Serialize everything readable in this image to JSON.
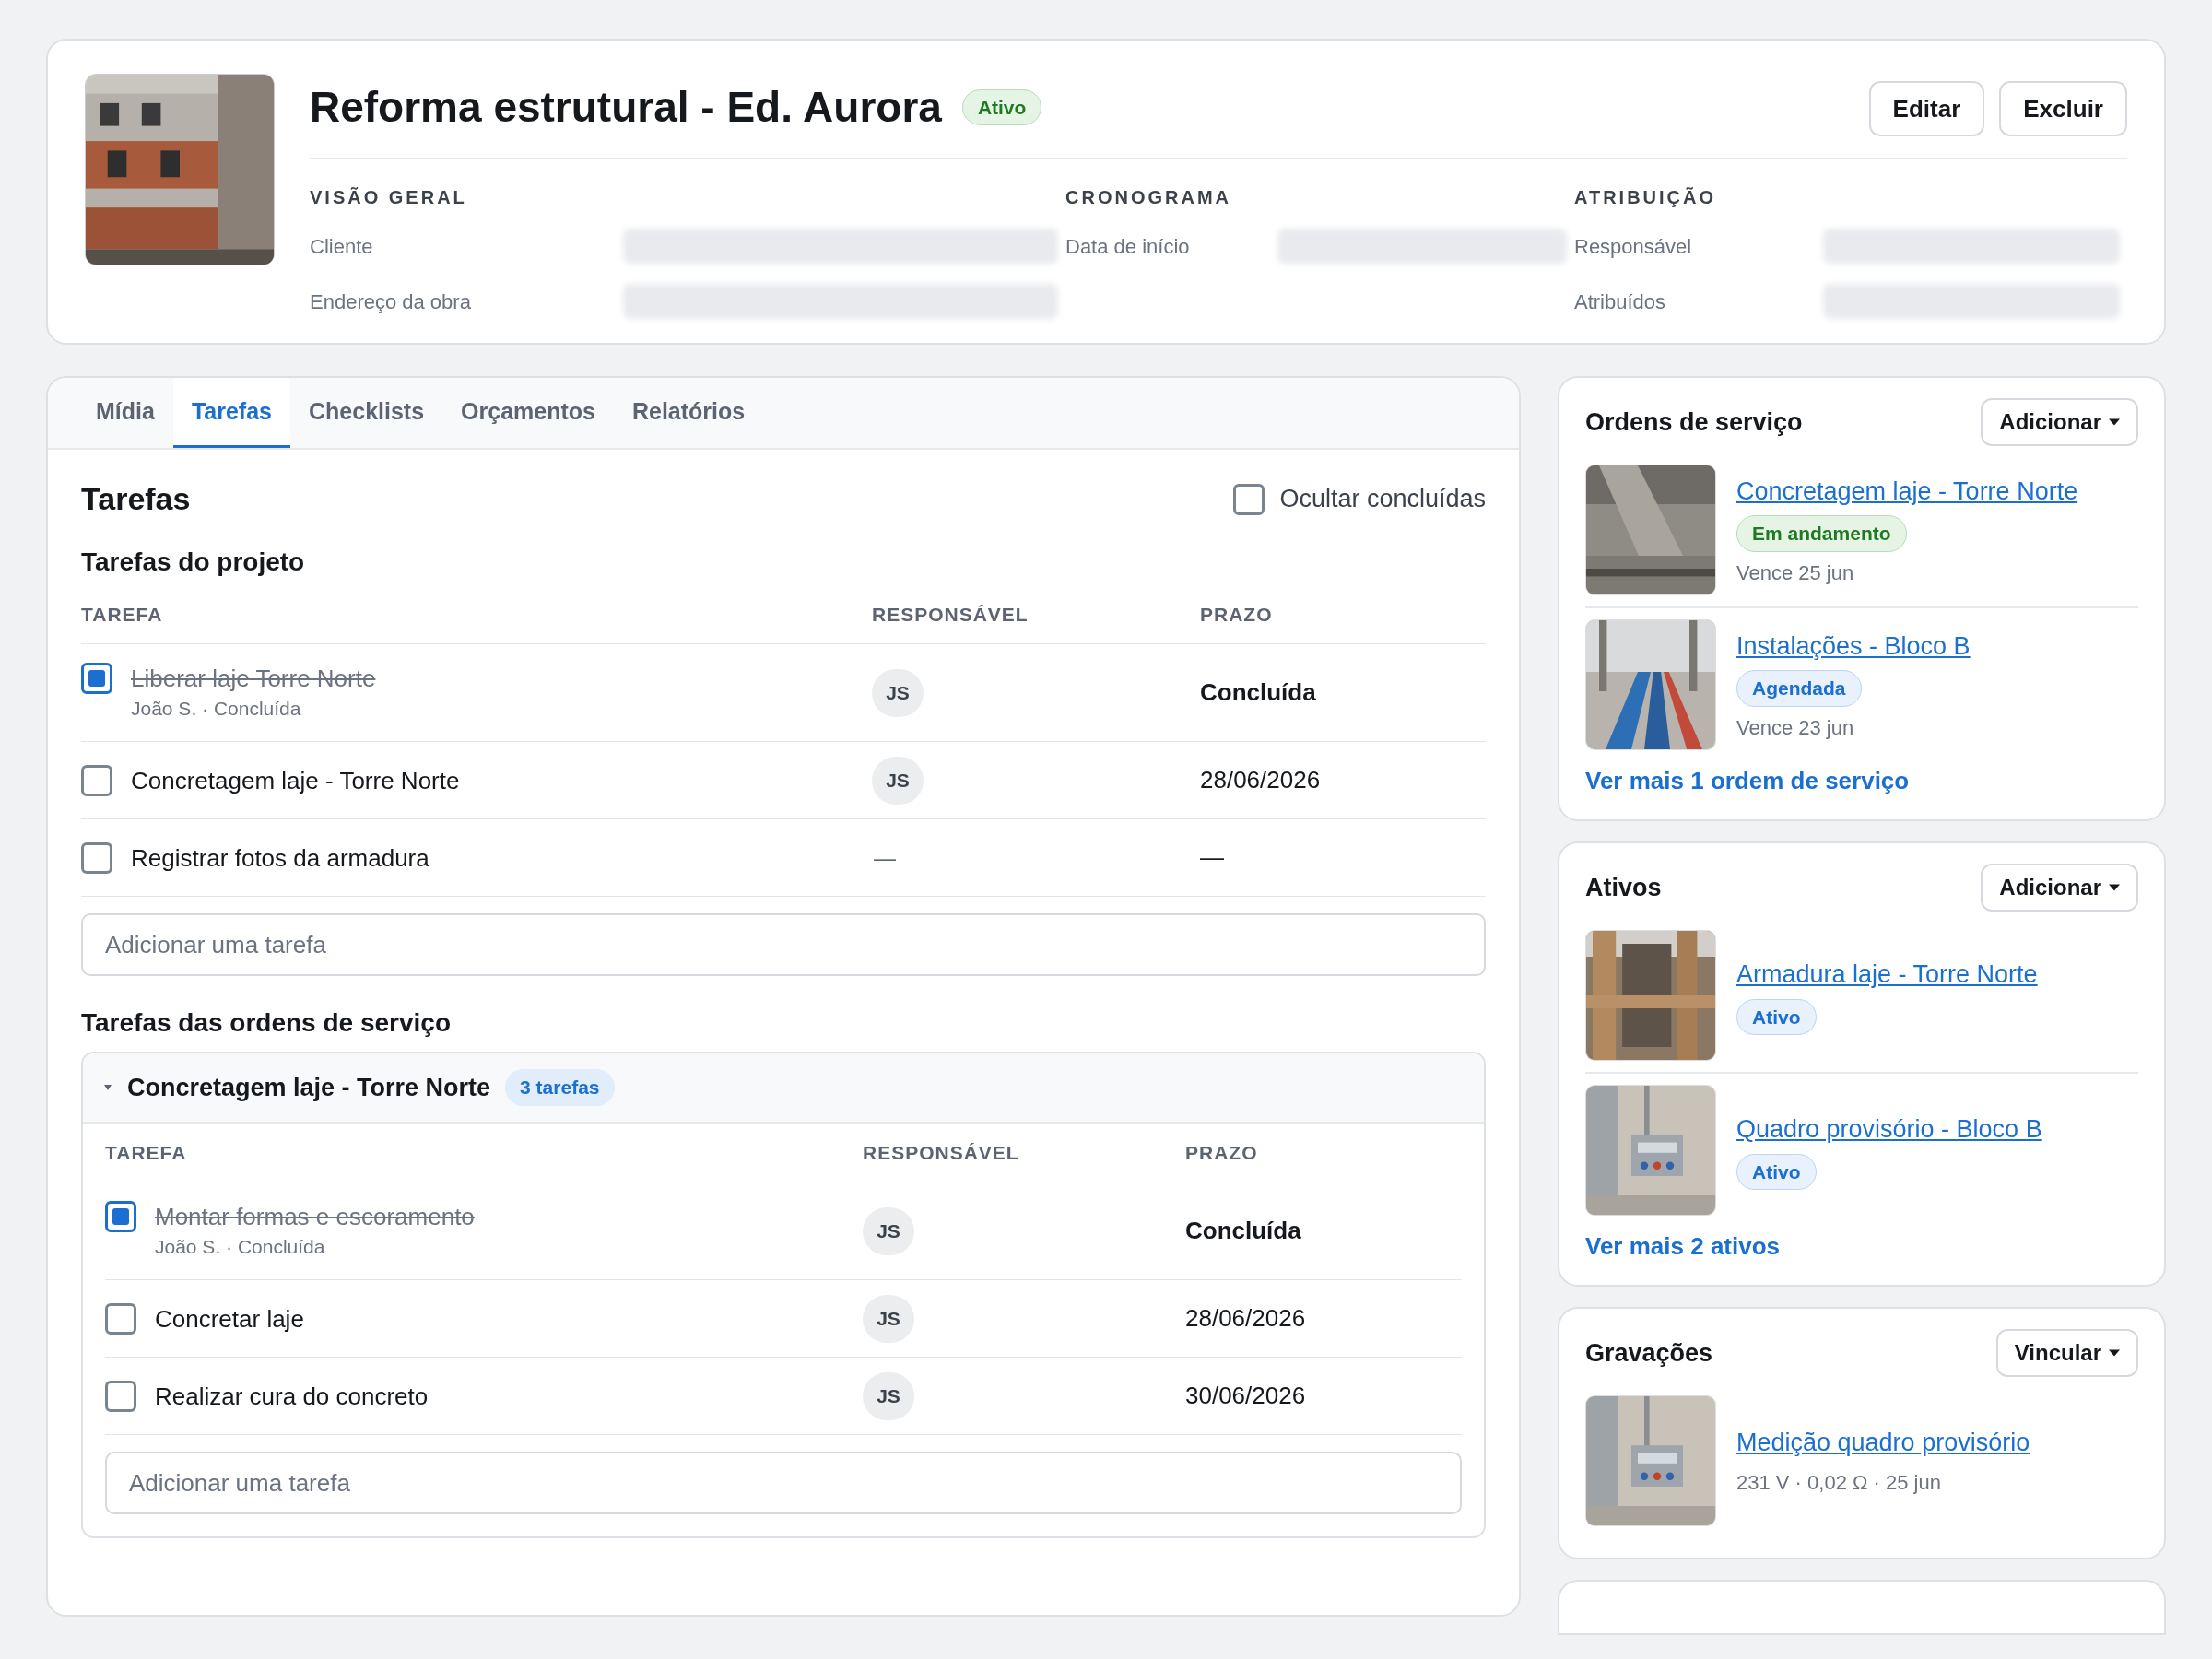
{
  "header": {
    "title": "Reforma estrutural - Ed. Aurora",
    "status": {
      "label": "Ativo",
      "kind": "success"
    },
    "actions": [
      "Editar",
      "Excluir"
    ],
    "sections": [
      {
        "heading": "VISÃO GERAL",
        "fields": [
          {
            "label": "Cliente"
          },
          {
            "label": "Endereço da obra"
          }
        ]
      },
      {
        "heading": "CRONOGRAMA",
        "fields": [
          {
            "label": "Data de início"
          }
        ]
      },
      {
        "heading": "ATRIBUIÇÃO",
        "fields": [
          {
            "label": "Responsável"
          },
          {
            "label": "Atribuídos"
          }
        ]
      }
    ]
  },
  "tabs": [
    {
      "label": "Mídia",
      "selected": false
    },
    {
      "label": "Tarefas",
      "selected": true
    },
    {
      "label": "Checklists",
      "selected": false
    },
    {
      "label": "Orçamentos",
      "selected": false
    },
    {
      "label": "Relatórios",
      "selected": false
    }
  ],
  "tasks": {
    "title": "Tarefas",
    "hide_completed": {
      "label": "Ocultar concluídas",
      "checked": false
    },
    "project": {
      "heading": "Tarefas do projeto",
      "columns": [
        "TAREFA",
        "RESPONSÁVEL",
        "PRAZO"
      ],
      "rows": [
        {
          "title": "Liberar laje Torre Norte",
          "done": true,
          "meta": "João S. · Concluída",
          "assignee": {
            "kind": "avatar",
            "text": "JS"
          },
          "due": "Concluída"
        },
        {
          "title": "Concretagem laje - Torre Norte",
          "done": false,
          "assignee": {
            "kind": "avatar",
            "text": "JS"
          },
          "due": "28/06/2026"
        },
        {
          "title": "Registrar fotos da armadura",
          "done": false,
          "assignee": {
            "kind": "empty",
            "text": "—"
          },
          "due": "—"
        }
      ],
      "add_placeholder": "Adicionar uma tarefa"
    },
    "orders": {
      "heading": "Tarefas das ordens de serviço",
      "groups": [
        {
          "title": "Concretagem laje - Torre Norte",
          "count": "3 tarefas",
          "expanded": true,
          "columns": [
            "TAREFA",
            "RESPONSÁVEL",
            "PRAZO"
          ],
          "rows": [
            {
              "title": "Montar formas e escoramento",
              "done": true,
              "meta": "João S. · Concluída",
              "assignee": {
                "kind": "avatar",
                "text": "JS"
              },
              "due": "Concluída"
            },
            {
              "title": "Concretar laje",
              "done": false,
              "assignee": {
                "kind": "avatar",
                "text": "JS"
              },
              "due": "28/06/2026"
            },
            {
              "title": "Realizar cura do concreto",
              "done": false,
              "assignee": {
                "kind": "avatar",
                "text": "JS"
              },
              "due": "30/06/2026"
            }
          ],
          "add_placeholder": "Adicionar uma tarefa"
        }
      ]
    }
  },
  "side_cards": [
    {
      "title": "Ordens de serviço",
      "action": "Adicionar",
      "items": [
        {
          "title": "Concretagem laje - Torre Norte",
          "status": {
            "label": "Em andamento",
            "kind": "success"
          },
          "note": "Vence 25 jun"
        },
        {
          "title": "Instalações - Bloco B",
          "status": {
            "label": "Agendada",
            "kind": "info"
          },
          "note": "Vence 23 jun"
        }
      ],
      "more": "Ver mais 1 ordem de serviço"
    },
    {
      "title": "Ativos",
      "action": "Adicionar",
      "items": [
        {
          "title": "Armadura laje - Torre Norte",
          "status": {
            "label": "Ativo",
            "kind": "info"
          }
        },
        {
          "title": "Quadro provisório - Bloco B",
          "status": {
            "label": "Ativo",
            "kind": "info"
          }
        }
      ],
      "more": "Ver mais 2 ativos"
    },
    {
      "title": "Gravações",
      "action": "Vincular",
      "items": [
        {
          "title": "Medição quadro provisório",
          "note": "231 V · 0,02 Ω · 25 jun"
        }
      ]
    }
  ]
}
